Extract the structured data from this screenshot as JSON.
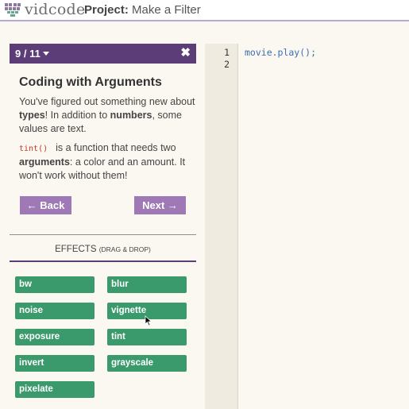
{
  "header": {
    "logo_text": "vidcode",
    "project_label": "Project:",
    "project_name": "Make a Filter"
  },
  "lesson": {
    "counter": "9 / 11",
    "title": "Coding with Arguments",
    "p1_a": "You've figured out something new about ",
    "p1_types": "types",
    "p1_b": "! In addition to ",
    "p1_numbers": "numbers",
    "p1_c": ", some values are text.",
    "p2_code": "tint()",
    "p2_a": "is a function that needs two ",
    "p2_arguments": "arguments",
    "p2_b": ": a color and an amount. It won't work without them!",
    "back_label": "← Back",
    "next_label": "Next →"
  },
  "effects": {
    "title": "EFFECTS",
    "subtitle": "(DRAG & DROP)",
    "items": [
      "bw",
      "blur",
      "noise",
      "vignette",
      "exposure",
      "tint",
      "invert",
      "grayscale",
      "pixelate"
    ]
  },
  "editor": {
    "line_numbers": [
      "1",
      "2"
    ],
    "lines": [
      "movie.play();",
      ""
    ]
  },
  "colors": {
    "accent_purple": "#5c3d78",
    "button_purple": "#9e79b5",
    "effect_green": "#3a9a6b",
    "code_blue": "#3b6fb0"
  }
}
